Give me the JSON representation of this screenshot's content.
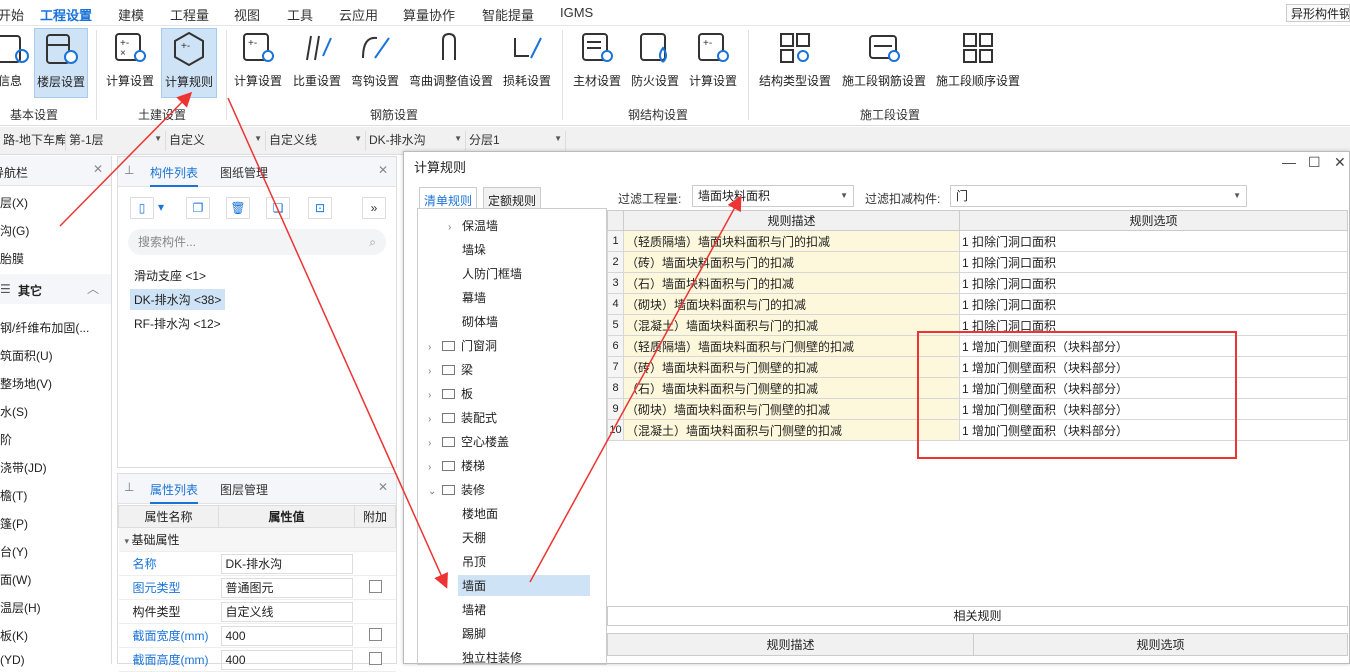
{
  "menu": {
    "items": [
      "开始",
      "工程设置",
      "建模",
      "工程量",
      "视图",
      "工具",
      "云应用",
      "算量协作",
      "智能提量",
      "IGMS"
    ],
    "active": "工程设置",
    "right_tool": "异形构件钢"
  },
  "ribbon": {
    "buttons": [
      "信息",
      "楼层设置",
      "计算设置",
      "计算规则",
      "计算设置",
      "比重设置",
      "弯钩设置",
      "弯曲调整值设置",
      "损耗设置",
      "主材设置",
      "防火设置",
      "计算设置",
      "结构类型设置",
      "施工段钢筋设置",
      "施工段顺序设置"
    ],
    "groups": [
      "基本设置",
      "土建设置",
      "钢筋设置",
      "钢结构设置",
      "施工段设置"
    ]
  },
  "toolbar": {
    "dropdowns": [
      "路-地下车库",
      "第-1层",
      "自定义",
      "自定义线",
      "DK-排水沟",
      "分层1"
    ]
  },
  "nav": {
    "title": "导航栏",
    "items": [
      "层(X)",
      "沟(G)",
      "胎膜",
      "其它",
      "钢/纤维布加固(...",
      "筑面积(U)",
      "整场地(V)",
      "水(S)",
      "阶",
      "浇带(JD)",
      "檐(T)",
      "篷(P)",
      "台(Y)",
      "面(W)",
      "温层(H)",
      "板(K)",
      "(YD)"
    ]
  },
  "components": {
    "tabs": [
      "构件列表",
      "图纸管理"
    ],
    "search_placeholder": "搜索构件...",
    "items": [
      "滑动支座 <1>",
      "DK-排水沟 <38>",
      "RF-排水沟 <12>"
    ],
    "selected": "DK-排水沟 <38>"
  },
  "properties": {
    "tabs": [
      "属性列表",
      "图层管理"
    ],
    "headers": [
      "属性名称",
      "属性值",
      "附加"
    ],
    "section": "基础属性",
    "rows": [
      {
        "name": "名称",
        "value": "DK-排水沟"
      },
      {
        "name": "图元类型",
        "value": "普通图元"
      },
      {
        "name": "构件类型",
        "value": "自定义线"
      },
      {
        "name": "截面宽度(mm)",
        "value": "400"
      },
      {
        "name": "截面高度(mm)",
        "value": "400"
      }
    ]
  },
  "dialog": {
    "title": "计算规则",
    "tabs": [
      "清单规则",
      "定额规则"
    ],
    "filter_label": "过滤工程量:",
    "filter_value": "墙面块料面积",
    "deduct_label": "过滤扣减构件:",
    "deduct_value": "门",
    "tree": [
      "保温墙",
      "墙垛",
      "人防门框墙",
      "幕墙",
      "砌体墙",
      "门窗洞",
      "梁",
      "板",
      "装配式",
      "空心楼盖",
      "楼梯",
      "装修",
      "楼地面",
      "天棚",
      "吊顶",
      "墙面",
      "墙裙",
      "踢脚",
      "独立柱装修"
    ],
    "tree_selected": "墙面",
    "grid_headers": [
      "规则描述",
      "规则选项"
    ],
    "rows": [
      {
        "n": "1",
        "desc": "（轻质隔墙）墙面块料面积与门的扣减",
        "opt": "1 扣除门洞口面积"
      },
      {
        "n": "2",
        "desc": "（砖）墙面块料面积与门的扣减",
        "opt": "1 扣除门洞口面积"
      },
      {
        "n": "3",
        "desc": "（石）墙面块料面积与门的扣减",
        "opt": "1 扣除门洞口面积"
      },
      {
        "n": "4",
        "desc": "（砌块）墙面块料面积与门的扣减",
        "opt": "1 扣除门洞口面积"
      },
      {
        "n": "5",
        "desc": "（混凝土）墙面块料面积与门的扣减",
        "opt": "1 扣除门洞口面积"
      },
      {
        "n": "6",
        "desc": "（轻质隔墙）墙面块料面积与门侧壁的扣减",
        "opt": "1 增加门侧壁面积（块料部分）"
      },
      {
        "n": "7",
        "desc": "（砖）墙面块料面积与门侧壁的扣减",
        "opt": "1 增加门侧壁面积（块料部分）"
      },
      {
        "n": "8",
        "desc": "（石）墙面块料面积与门侧壁的扣减",
        "opt": "1 增加门侧壁面积（块料部分）"
      },
      {
        "n": "9",
        "desc": "（砌块）墙面块料面积与门侧壁的扣减",
        "opt": "1 增加门侧壁面积（块料部分）"
      },
      {
        "n": "10",
        "desc": "（混凝土）墙面块料面积与门侧壁的扣减",
        "opt": "1 增加门侧壁面积（块料部分）"
      }
    ],
    "related_label": "相关规则",
    "related_headers": [
      "规则描述",
      "规则选项"
    ]
  },
  "colors": {
    "accent": "#1a73d9",
    "selected_bg": "#cfe3f6",
    "desc_bg": "#fdf8dc",
    "annotation": "#e33"
  }
}
